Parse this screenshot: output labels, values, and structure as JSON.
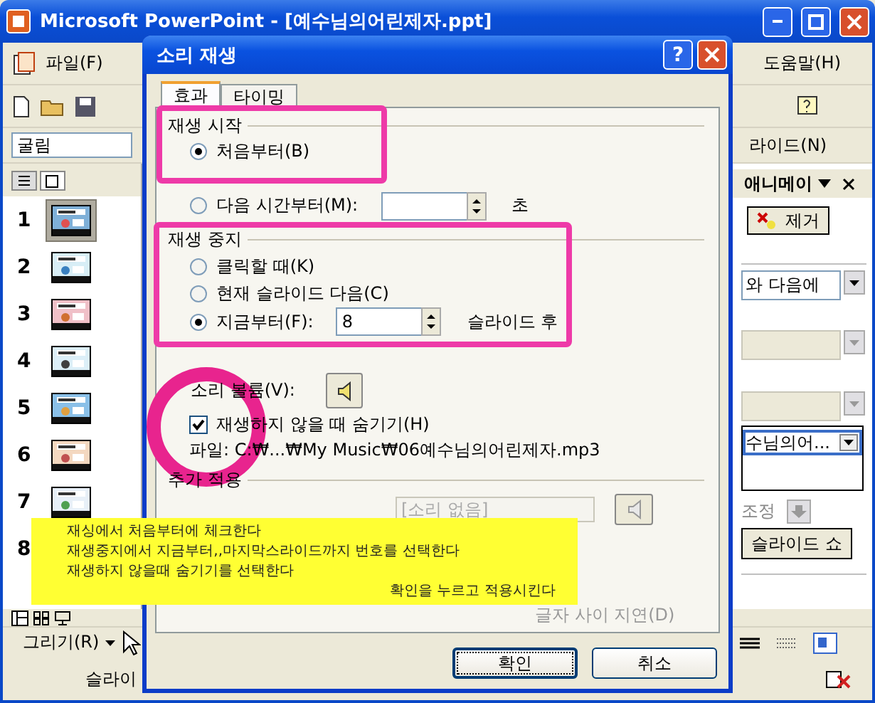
{
  "window": {
    "title": "Microsoft PowerPoint - [예수님의어린제자.ppt]"
  },
  "menu": {
    "left": "파일(F)",
    "right": "도움말(H)"
  },
  "toolbar": {
    "font": "굴림",
    "slide_menu": "라이드(N)"
  },
  "slides_panel": {
    "tabs": [
      {
        "kind": "outline",
        "selected": false
      },
      {
        "kind": "slides",
        "selected": true
      }
    ],
    "slides": [
      {
        "number": "1",
        "selected": true
      },
      {
        "number": "2",
        "selected": false
      },
      {
        "number": "3",
        "selected": false
      },
      {
        "number": "4",
        "selected": false
      },
      {
        "number": "5",
        "selected": false
      },
      {
        "number": "6",
        "selected": false
      },
      {
        "number": "7",
        "selected": false
      }
    ],
    "more_slide_numbers": [
      "8"
    ]
  },
  "task_pane": {
    "title": "애니메이",
    "remove_button": "제거",
    "start_value": "와 다음에",
    "sound_item": "수님의어...",
    "reorder_label": "조정",
    "slideshow_button": "슬라이드 쇼"
  },
  "drawing_toolbar": {
    "label": "그리기(R)"
  },
  "status_bar": {
    "text": "슬라이"
  },
  "dialog": {
    "title": "소리 재생",
    "help_button": "?",
    "tabs": [
      {
        "label": "효과",
        "selected": true
      },
      {
        "label": "타이밍",
        "selected": false
      }
    ],
    "start_group": {
      "label": "재생 시작",
      "options": [
        {
          "label": "처음부터(B)",
          "selected": true
        },
        {
          "label": "다음 시간부터(M):",
          "selected": false,
          "unit": "초"
        }
      ]
    },
    "stop_group": {
      "label": "재생 중지",
      "options": [
        {
          "label": "클릭할 때(K)",
          "selected": false
        },
        {
          "label": "현재 슬라이드 다음(C)",
          "selected": false
        },
        {
          "label": "지금부터(F):",
          "selected": true,
          "value": "8",
          "unit": "슬라이드 후"
        }
      ]
    },
    "volume_label": "소리 볼륨(V):",
    "hide_checkbox": {
      "label": "재생하지 않을 때 숨기기(H)",
      "checked": true
    },
    "file": "파일:   C:₩...₩My Music₩06예수님의어린제자.mp3",
    "extra_group": {
      "label": "추가 적용",
      "sound_value": "[소리 없음]",
      "delay_label": "글자 사이 지연(D)"
    },
    "buttons": [
      {
        "label": "확인",
        "default": true
      },
      {
        "label": "취소",
        "default": false
      }
    ]
  },
  "note": {
    "lines": [
      "재싱에서 처음부터에 체크한다",
      "재생중지에서 지금부터,,마지막스라이드까지 번호를 선택한다",
      "재생하지 않을때 숨기기를 선택한다"
    ],
    "last_line": "확인을 누르고 적용시킨다"
  }
}
